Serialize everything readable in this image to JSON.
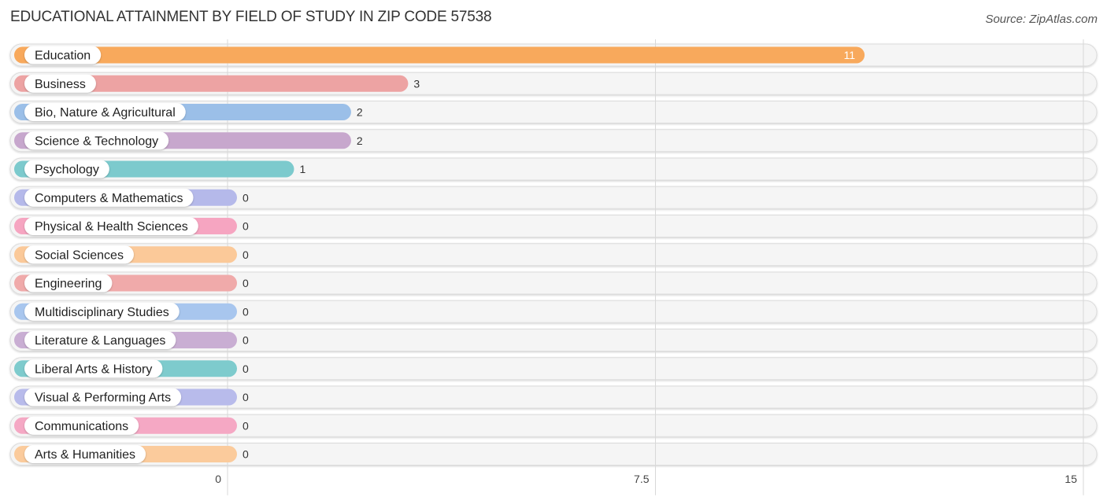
{
  "header": {
    "title": "EDUCATIONAL ATTAINMENT BY FIELD OF STUDY IN ZIP CODE 57538",
    "source": "Source: ZipAtlas.com"
  },
  "chart_data": {
    "type": "bar",
    "orientation": "horizontal",
    "title": "EDUCATIONAL ATTAINMENT BY FIELD OF STUDY IN ZIP CODE 57538",
    "xlabel": "",
    "ylabel": "",
    "xlim": [
      0,
      15
    ],
    "ticks": [
      0,
      7.5,
      15
    ],
    "tick_labels": [
      "0",
      "7.5",
      "15"
    ],
    "grid": true,
    "categories": [
      "Education",
      "Business",
      "Bio, Nature & Agricultural",
      "Science & Technology",
      "Psychology",
      "Computers & Mathematics",
      "Physical & Health Sciences",
      "Social Sciences",
      "Engineering",
      "Multidisciplinary Studies",
      "Literature & Languages",
      "Liberal Arts & History",
      "Visual & Performing Arts",
      "Communications",
      "Arts & Humanities"
    ],
    "values": [
      11,
      3,
      2,
      2,
      1,
      0,
      0,
      0,
      0,
      0,
      0,
      0,
      0,
      0,
      0
    ],
    "colors": [
      "#f8a95c",
      "#eda3a3",
      "#9bbfe8",
      "#c7a7cd",
      "#7ccacd",
      "#b5b9ea",
      "#f6a5c1",
      "#fbc999",
      "#f0aaaa",
      "#a8c6ee",
      "#c9aed3",
      "#7ecbcd",
      "#b8bbeb",
      "#f5a8c4",
      "#fbcb9c"
    ]
  }
}
